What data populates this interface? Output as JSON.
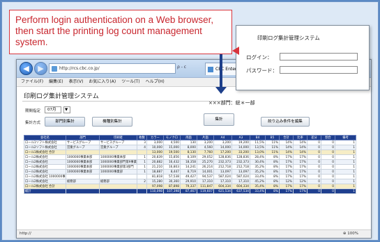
{
  "callout": {
    "text": "Perform login authentication on a Web browser, then start the printing log count management system."
  },
  "login_dialog": {
    "title": "印刷ログ集計管理システム",
    "login_label": "ログイン：",
    "password_label": "パスワード："
  },
  "browser": {
    "address": "http://rcs.cbc.co.jp/",
    "address_tools": "ρ - c",
    "tab_title": "CBC Enterprise Informa...",
    "tab_close": "×",
    "back": "◀",
    "forward": "▶",
    "menu": [
      "ファイル(F)",
      "編集(E)",
      "表示(V)",
      "お気に入り(A)",
      "ツール(T)",
      "ヘルプ(H)"
    ],
    "status_left": "http://",
    "zoom": "100%"
  },
  "app": {
    "title": "印刷ログ集計管理システム",
    "dept": "×××部門：総＊一部",
    "period_label": "期間指定",
    "period_value": "07月",
    "period_btn": "▼",
    "method_label": "集計方式",
    "btn_dept": "部門別集計",
    "btn_device": "機種別集計",
    "btn_aggregate": "集計",
    "btn_filter": "絞り込み条件を編集"
  },
  "table": {
    "headers": [
      "会社名",
      "部門",
      "印刷者",
      "枚数",
      "カラー",
      "モノクロ",
      "両面",
      "片面",
      "A4",
      "A3",
      "B4",
      "B5",
      "合計",
      "比率",
      "差分",
      "割合",
      "備考"
    ],
    "rows": [
      {
        "cls": "",
        "cells": [
          "ロール1ソフト株式会社",
          "サービスグループ",
          "サービスグループ",
          "3",
          "3,000",
          "4,500",
          "130",
          "3,200",
          "3,200",
          "19,200",
          "11,5%",
          "11%",
          "14%",
          "14%",
          "0",
          "0",
          "1"
        ]
      },
      {
        "cls": "alt",
        "cells": [
          "ロール2ソフト株式会社",
          "営業グループ",
          "営業グループ",
          "4",
          "10,000",
          "15,000",
          "8,000",
          "4,560",
          "14,000",
          "14,000",
          "13,5%",
          "11%",
          "14%",
          "14%",
          "0",
          "0",
          "1"
        ]
      },
      {
        "cls": "hl",
        "cells": [
          "ロール1株式会社 合計",
          "",
          "",
          "",
          "13,000",
          "19,500",
          "8,130",
          "7,760",
          "17,200",
          "33,200",
          "13,0%",
          "11%",
          "14%",
          "14%",
          "0",
          "0",
          "1"
        ]
      },
      {
        "cls": "",
        "cells": [
          "ロール2株式会社",
          "1000000事業本部",
          "1000000事業本部",
          "1",
          "20,839",
          "15,856",
          "8,109",
          "29,052",
          "128,836",
          "128,836",
          "28,4%",
          "8%",
          "17%",
          "17%",
          "0",
          "0",
          "1"
        ]
      },
      {
        "cls": "alt",
        "cells": [
          "ロール2株式会社",
          "1000000事業本部",
          "1000000事業部門第9事業部",
          "1",
          "20,882",
          "16,432",
          "18,358",
          "25,270",
          "232,373",
          "232,373",
          "30,4%",
          "8%",
          "17%",
          "17%",
          "0",
          "0",
          "1"
        ]
      },
      {
        "cls": "",
        "cells": [
          "ロール2株式会社",
          "1000000事業本部",
          "1000000事業部第3部門",
          "1",
          "21,210",
          "16,803",
          "14,241",
          "26,214",
          "212,718",
          "212,718",
          "35,2%",
          "8%",
          "17%",
          "17%",
          "0",
          "0",
          "1"
        ]
      },
      {
        "cls": "alt",
        "cells": [
          "ロール2株式会社",
          "1000000事業本部",
          "1000000事業部",
          "1",
          "18,887",
          "8,447",
          "8,719",
          "14,001",
          "13,097",
          "13,097",
          "35,2%",
          "8%",
          "17%",
          "17%",
          "0",
          "0",
          "1"
        ]
      },
      {
        "cls": "",
        "cells": [
          "ロール2株式会社 1000000事業本部 合計",
          "",
          "",
          "",
          "81,818",
          "57,538",
          "49,427",
          "94,537",
          "587,024",
          "587,024",
          "33,4%",
          "8%",
          "17%",
          "17%",
          "0",
          "0",
          "1"
        ]
      },
      {
        "cls": "alt",
        "cells": [
          "ロール2株式会社",
          "総務部",
          "総務部",
          "2",
          "15,280",
          "30,360",
          "29,910",
          "17,310",
          "17,310",
          "17,310",
          "45,2%",
          "8%",
          "12%",
          "12%",
          "0",
          "0",
          "1"
        ]
      },
      {
        "cls": "hl",
        "cells": [
          "ロール2株式会社 合計",
          "",
          "",
          "",
          "97,098",
          "87,898",
          "79,337",
          "111,847",
          "604,334",
          "604,334",
          "35,4%",
          "8%",
          "17%",
          "17%",
          "0",
          "0",
          "1"
        ]
      },
      {
        "cls": "total",
        "cells": [
          "総計",
          "",
          "",
          "",
          "110,098",
          "107,398",
          "87,467",
          "119,607",
          "621,534",
          "637,534",
          "33,4%",
          "8%",
          "17%",
          "17%",
          "0",
          "0",
          "1"
        ]
      }
    ]
  }
}
